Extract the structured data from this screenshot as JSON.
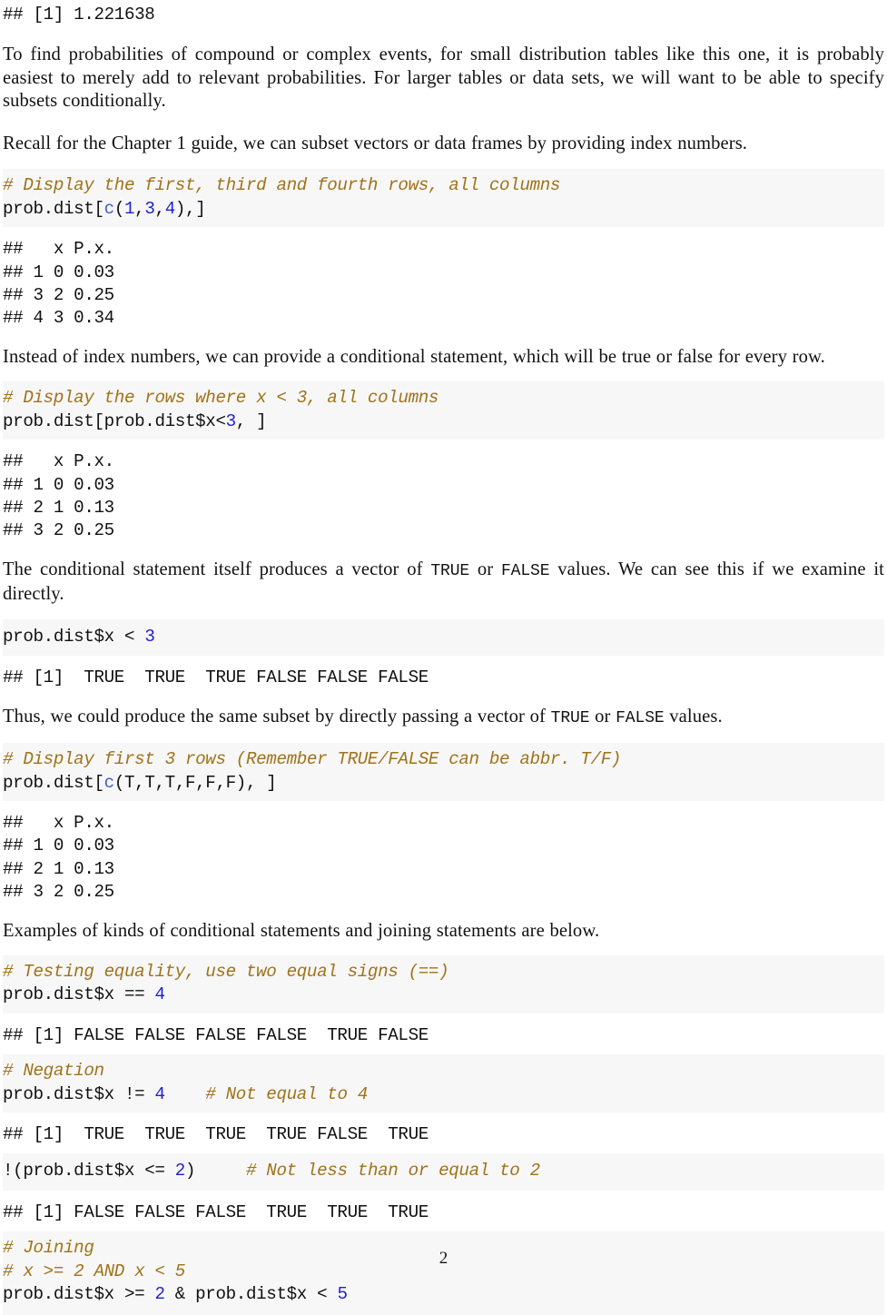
{
  "document": {
    "page_number": "2",
    "colors": {
      "chunk_background": "#f7f7f7",
      "page_background": "#ffffff",
      "comment": "#a0721a",
      "number_literal": "#2020cc",
      "function_name": "#3c60c8",
      "body_text": "#121212"
    }
  },
  "blocks": {
    "output_0": "## [1] 1.221638",
    "para_1": "To find probabilities of compound or complex events, for small distribution tables like this one, it is probably easiest to merely add to relevant probabilities. For larger tables or data sets, we will want to be able to specify subsets conditionally.",
    "para_2": "Recall for the Chapter 1 guide, we can subset vectors or data frames by providing index numbers.",
    "chunk_1": {
      "comment": "# Display the first, third and fourth rows, all columns",
      "code_prefix": "prob.dist[",
      "code_fn": "c",
      "code_open": "(",
      "n1": "1",
      "sep1": ",",
      "n2": "3",
      "sep2": ",",
      "n3": "4",
      "code_suffix": "),]"
    },
    "output_1": "##   x P.x.\n## 1 0 0.03\n## 3 2 0.25\n## 4 3 0.34",
    "para_3": "Instead of index numbers, we can provide a conditional statement, which will be true or false for every row.",
    "chunk_2": {
      "comment": "# Display the rows where x < 3, all columns",
      "code_prefix": "prob.dist[prob.dist$x<",
      "n1": "3",
      "code_suffix": ", ]"
    },
    "output_2": "##   x P.x.\n## 1 0 0.03\n## 2 1 0.13\n## 3 2 0.25",
    "para_4_a": "The conditional statement itself produces a vector of ",
    "para_4_true": "TRUE",
    "para_4_b": " or ",
    "para_4_false": "FALSE",
    "para_4_c": " values. We can see this if we examine it directly.",
    "chunk_3": {
      "code_prefix": "prob.dist$x < ",
      "n1": "3"
    },
    "output_3": "## [1]  TRUE  TRUE  TRUE FALSE FALSE FALSE",
    "para_5_a": "Thus, we could produce the same subset by directly passing a vector of ",
    "para_5_true": "TRUE",
    "para_5_b": " or ",
    "para_5_false": "FALSE",
    "para_5_c": " values.",
    "chunk_4": {
      "comment": "# Display first 3 rows (Remember TRUE/FALSE can be abbr. T/F)",
      "code_prefix": "prob.dist[",
      "code_fn": "c",
      "code_suffix": "(T,T,T,F,F,F), ]"
    },
    "output_4": "##   x P.x.\n## 1 0 0.03\n## 2 1 0.13\n## 3 2 0.25",
    "para_6": "Examples of kinds of conditional statements and joining statements are below.",
    "chunk_5": {
      "comment": "# Testing equality, use two equal signs (==)",
      "code_prefix": "prob.dist$x == ",
      "n1": "4"
    },
    "output_5": "## [1] FALSE FALSE FALSE FALSE  TRUE FALSE",
    "chunk_6": {
      "comment": "# Negation",
      "code_prefix": "prob.dist$x != ",
      "n1": "4",
      "code_gap": "    ",
      "trailing_comment": "# Not equal to 4"
    },
    "output_6": "## [1]  TRUE  TRUE  TRUE  TRUE FALSE  TRUE",
    "chunk_7": {
      "code_prefix": "!(prob.dist$x <= ",
      "n1": "2",
      "code_suffix": ")",
      "code_gap": "     ",
      "trailing_comment": "# Not less than or equal to 2"
    },
    "output_7": "## [1] FALSE FALSE FALSE  TRUE  TRUE  TRUE",
    "chunk_8": {
      "comment_1": "# Joining",
      "comment_2": "# x >= 2 AND x < 5",
      "code_prefix": "prob.dist$x >= ",
      "n1": "2",
      "code_mid": " & prob.dist$x < ",
      "n2": "5"
    }
  }
}
